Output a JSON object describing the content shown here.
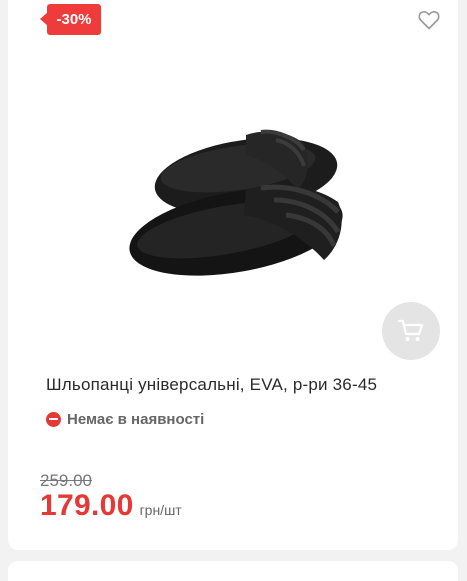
{
  "product": {
    "discount_badge": "-30%",
    "title": "Шльопанці універсальні, EVA, р-ри 36-45",
    "stock_status": "Немає в наявності",
    "old_price": "259.00",
    "price": "179.00",
    "unit": "грн/шт"
  },
  "icons": {
    "favorite": "heart-icon",
    "cart": "cart-icon",
    "stock": "minus-circle-icon"
  },
  "colors": {
    "accent": "#e53935",
    "badge": "#ef3b3b",
    "cart_button_bg": "#e4e4e4",
    "status_text": "#666666"
  }
}
